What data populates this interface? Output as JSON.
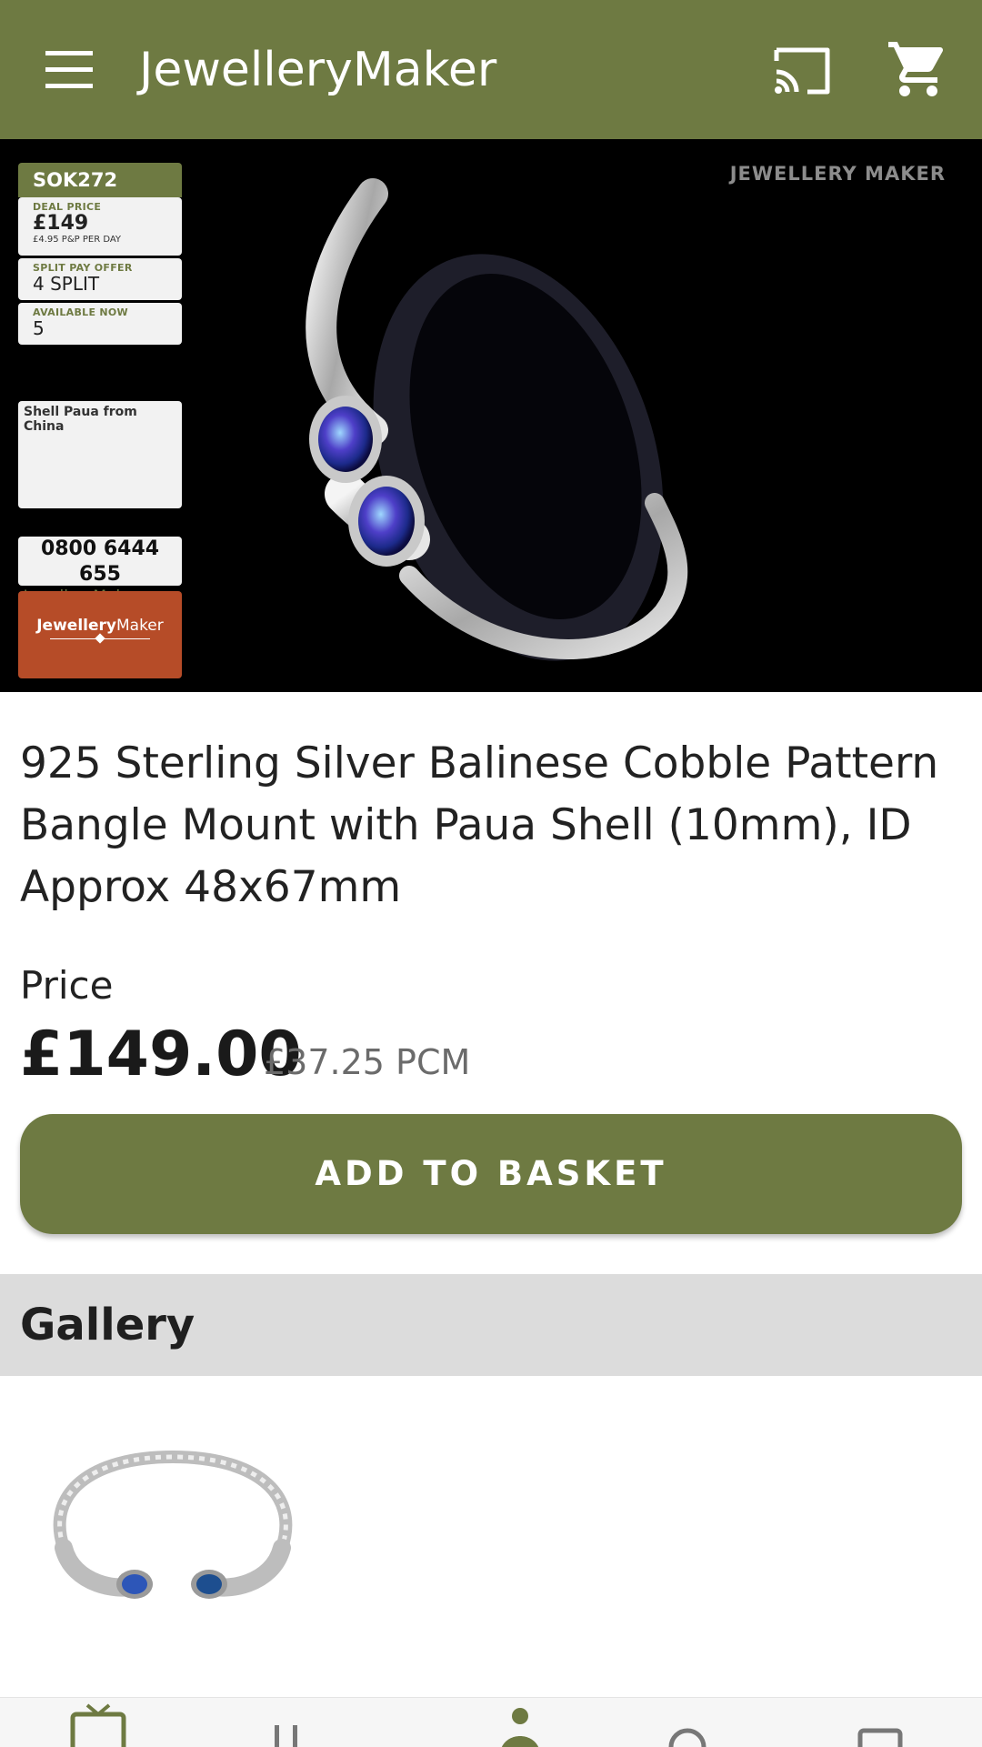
{
  "app": {
    "title": "JewelleryMaker",
    "accent_color": "#6e7a42",
    "menu_icon": "hamburger-menu-icon",
    "cast_icon": "cast-icon",
    "cart_icon": "shopping-cart-icon"
  },
  "hero": {
    "watermark": "JEWELLERY MAKER",
    "code": "SOK272",
    "deal_label": "DEAL PRICE",
    "deal_price": "£149",
    "pp_note": "£4.95 P&P PER DAY",
    "split_label": "SPLIT PAY OFFER",
    "split_value": "4 SPLIT",
    "available_label": "AVAILABLE NOW",
    "available_value": "5",
    "origin_note": "Shell Paua from China",
    "phone": "0800 6444 655",
    "website": "JewelleryMaker.com",
    "brand_bold": "Jewellery",
    "brand_light": "Maker"
  },
  "product": {
    "title": "925 Sterling Silver Balinese Cobble Pattern Bangle Mount with Paua Shell (10mm), ID Approx 48x67mm",
    "price_label": "Price",
    "price": "£149.00",
    "price_pcm": "£37.25 PCM",
    "add_button": "ADD TO BASKET"
  },
  "gallery": {
    "header": "Gallery",
    "items": [
      "bangle-thumbnail"
    ]
  },
  "bottom_nav": {
    "icons": [
      "tv-icon",
      "search-icon",
      "person-icon",
      "help-icon",
      "account-icon"
    ]
  }
}
